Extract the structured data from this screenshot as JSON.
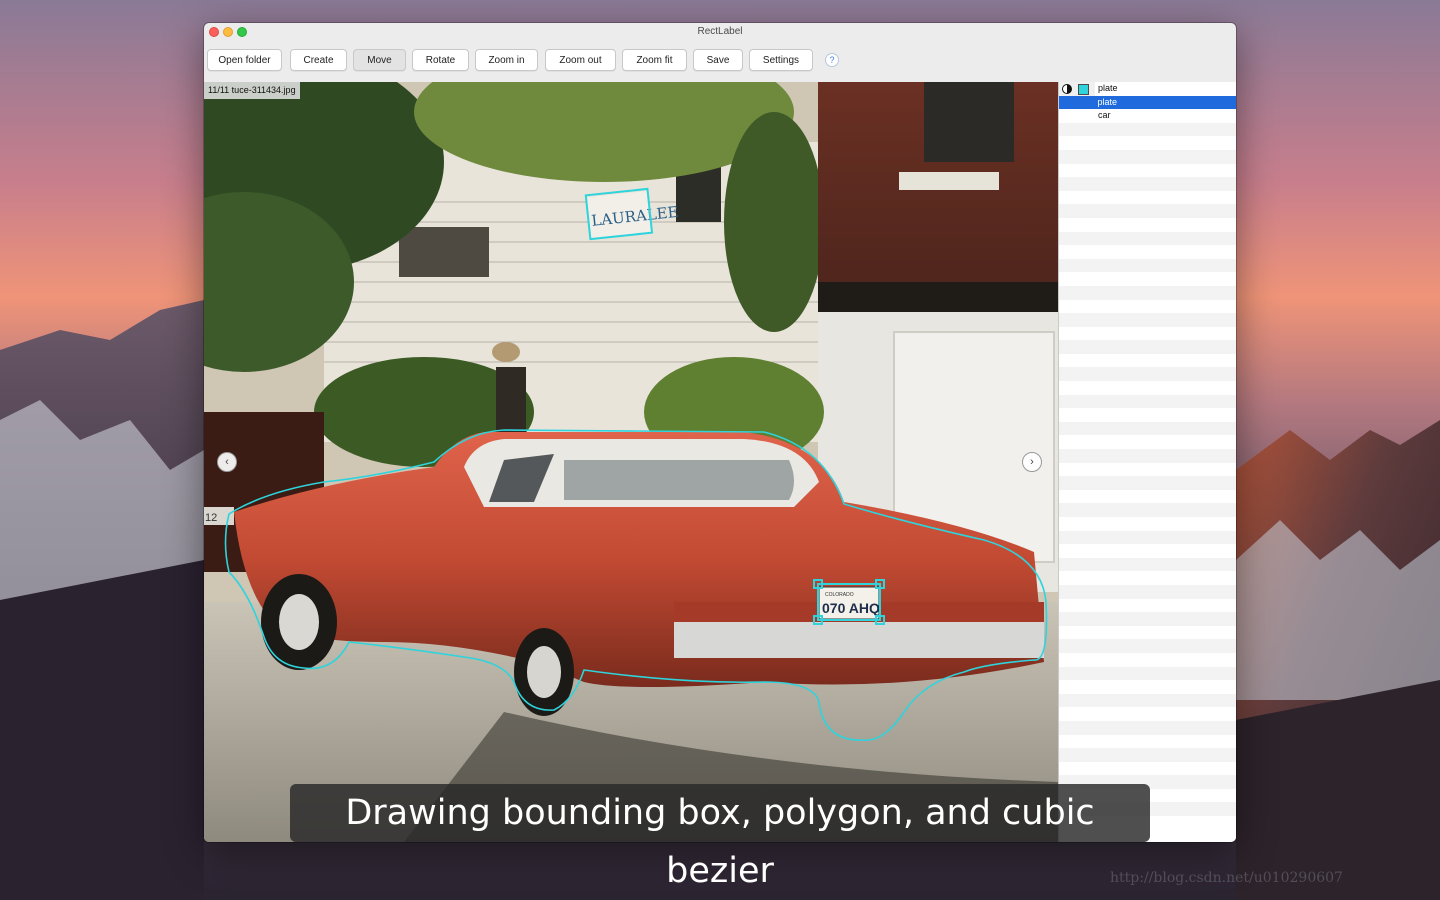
{
  "window": {
    "title": "RectLabel"
  },
  "toolbar": {
    "buttons": [
      {
        "id": "open-folder",
        "label": "Open folder",
        "active": false
      },
      {
        "id": "create",
        "label": "Create",
        "active": false
      },
      {
        "id": "move",
        "label": "Move",
        "active": true
      },
      {
        "id": "rotate",
        "label": "Rotate",
        "active": false
      },
      {
        "id": "zoom-in",
        "label": "Zoom in",
        "active": false
      },
      {
        "id": "zoom-out",
        "label": "Zoom out",
        "active": false
      },
      {
        "id": "zoom-fit",
        "label": "Zoom fit",
        "active": false
      },
      {
        "id": "save",
        "label": "Save",
        "active": false
      },
      {
        "id": "settings",
        "label": "Settings",
        "active": false
      }
    ],
    "help_label": "?"
  },
  "image": {
    "file_label": "11/11 tuce-311434.jpg",
    "sign_text": "LAURALEE",
    "plate_text": "070 AHQ",
    "plate_state": "COLORADO",
    "side_plate_text": "12"
  },
  "navigation": {
    "prev_glyph": "‹",
    "next_glyph": "›"
  },
  "label_panel": {
    "accent_color": "#2fd3dc",
    "selection_color": "#1f6bde",
    "labels": [
      {
        "name": "plate",
        "selected": false
      },
      {
        "name": "plate",
        "selected": true
      },
      {
        "name": "car",
        "selected": false
      }
    ]
  },
  "caption": {
    "text": "Drawing bounding box, polygon, and cubic bezier"
  },
  "desktop": {
    "watermark": "http://blog.csdn.net/u010290607"
  }
}
